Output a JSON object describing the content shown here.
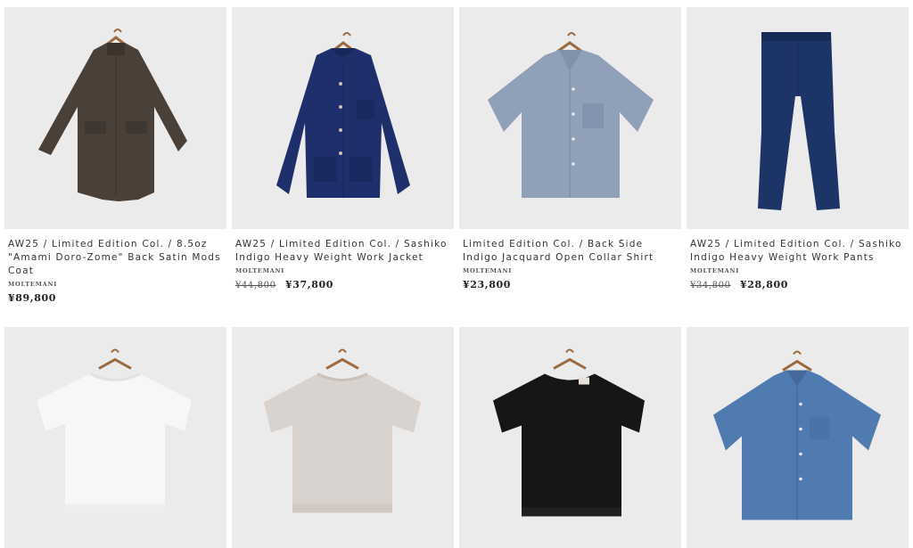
{
  "products": [
    {
      "title": "AW25 / Limited Edition Col. / 8.5oz \"Amami Doro-Zome\" Back Satin Mods Coat",
      "brand": "MOLTEMANI",
      "old_price": "",
      "price": "¥89,800",
      "garment": "mods-coat",
      "color": "#4a4038"
    },
    {
      "title": "AW25 / Limited Edition Col. / Sashiko Indigo Heavy Weight Work Jacket",
      "brand": "MOLTEMANI",
      "old_price": "¥44,800",
      "price": "¥37,800",
      "garment": "work-jacket",
      "color": "#1f2f6b"
    },
    {
      "title": "Limited Edition Col. / Back Side Indigo Jacquard Open Collar Shirt",
      "brand": "MOLTEMANI",
      "old_price": "",
      "price": "¥23,800",
      "garment": "open-collar-shirt",
      "color": "#8fa0b8"
    },
    {
      "title": "AW25 / Limited Edition Col. / Sashiko Indigo Heavy Weight Work Pants",
      "brand": "MOLTEMANI",
      "old_price": "¥34,800",
      "price": "¥28,800",
      "garment": "work-pants",
      "color": "#1d3466"
    },
    {
      "garment": "knit-tee",
      "color": "#f7f7f5"
    },
    {
      "garment": "knit-tee",
      "color": "#d9d3cf"
    },
    {
      "garment": "knit-tee",
      "color": "#161616"
    },
    {
      "garment": "denim-shirt",
      "color": "#4f7bb0"
    }
  ],
  "colors": {
    "background": "#ffffff",
    "photo_bg": "#ebebeb",
    "hanger": "#9a6a3e"
  }
}
